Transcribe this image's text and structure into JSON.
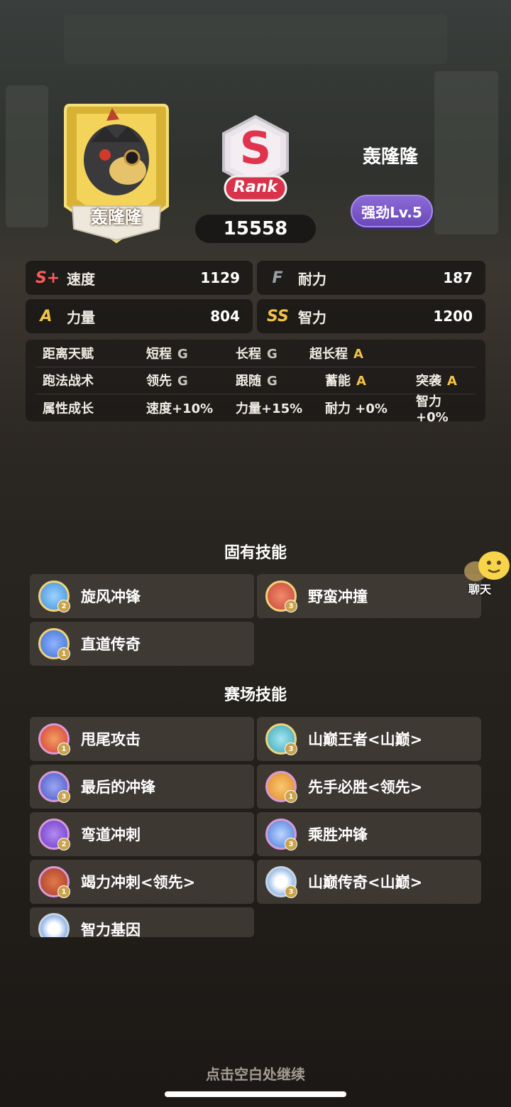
{
  "character": {
    "card_name": "轰隆隆",
    "name": "轰隆隆",
    "rank_letter": "S",
    "rank_label": "Rank",
    "score": "15558",
    "level": "强劲Lv.5"
  },
  "stats": [
    {
      "grade": "S+",
      "label": "速度",
      "value": "1129",
      "color": "#ff5a5a"
    },
    {
      "grade": "F",
      "label": "耐力",
      "value": "187",
      "color": "#9aa0a6"
    },
    {
      "grade": "A",
      "label": "力量",
      "value": "804",
      "color": "#f3c24a"
    },
    {
      "grade": "SS",
      "label": "智力",
      "value": "1200",
      "color": "#f3c24a"
    }
  ],
  "attributes": {
    "distance": {
      "header": "距离天赋",
      "items": [
        {
          "name": "短程",
          "grade": "G"
        },
        {
          "name": "长程",
          "grade": "G"
        },
        {
          "name": "超长程",
          "grade": "A"
        }
      ]
    },
    "tactics": {
      "header": "跑法战术",
      "items": [
        {
          "name": "领先",
          "grade": "G"
        },
        {
          "name": "跟随",
          "grade": "G"
        },
        {
          "name": "蓄能",
          "grade": "A"
        },
        {
          "name": "突袭",
          "grade": "A"
        }
      ]
    },
    "growth": {
      "header": "属性成长",
      "items": [
        "速度+10%",
        "力量+15%",
        "耐力 +0%",
        "智力 +0%"
      ]
    },
    "grade_colors": {
      "G": "#c9c4bc",
      "A": "#f3c24a"
    }
  },
  "innate_skills": {
    "title": "固有技能",
    "items": [
      {
        "name": "旋风冲锋",
        "level": "2",
        "icon": "whirlwind-charge-icon",
        "color": "#3d8fd8"
      },
      {
        "name": "野蛮冲撞",
        "level": "3",
        "icon": "dragon-head-icon",
        "color": "#c8463a"
      },
      {
        "name": "直道传奇",
        "level": "1",
        "icon": "lightning-icon",
        "color": "#3e6fd0"
      }
    ]
  },
  "race_skills": {
    "title": "赛场技能",
    "items": [
      {
        "name": "甩尾攻击",
        "level": "1",
        "icon": "tail-swipe-icon",
        "color": "#d83a3a"
      },
      {
        "name": "山巅王者<山巅>",
        "level": "3",
        "icon": "mountain-king-icon",
        "color": "#3aa6b8"
      },
      {
        "name": "最后的冲锋",
        "level": "3",
        "icon": "final-charge-icon",
        "color": "#4a58c8"
      },
      {
        "name": "先手必胜<领先>",
        "level": "1",
        "icon": "first-strike-icon",
        "color": "#e08a2a"
      },
      {
        "name": "弯道冲刺",
        "level": "2",
        "icon": "corner-sprint-icon",
        "color": "#6a3ac8"
      },
      {
        "name": "乘胜冲锋",
        "level": "3",
        "icon": "victory-charge-icon",
        "color": "#4a7ad8"
      },
      {
        "name": "竭力冲刺<领先>",
        "level": "1",
        "icon": "exhaust-sprint-icon",
        "color": "#a83a2a"
      },
      {
        "name": "山巅传奇<山巅>",
        "level": "3",
        "icon": "mountain-legend-icon",
        "color": "#4a8ad8"
      },
      {
        "name": "智力基因",
        "level": "",
        "icon": "intellect-gene-icon",
        "color": "#3a7ad8"
      }
    ]
  },
  "chat": {
    "label": "聊天"
  },
  "footer": {
    "hint": "点击空白处继续"
  }
}
